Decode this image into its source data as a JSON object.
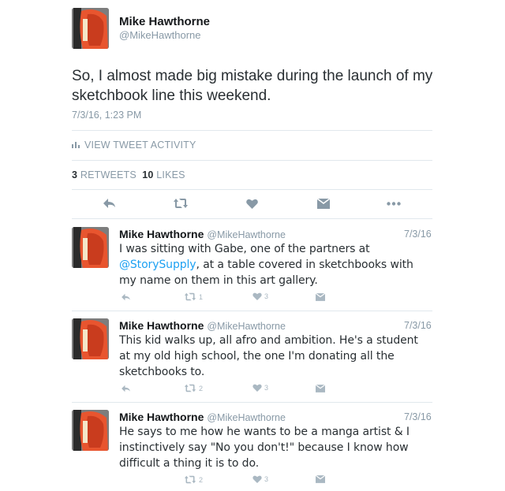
{
  "main_tweet": {
    "user_name": "Mike Hawthorne",
    "handle": "@MikeHawthorne",
    "text": "So, I almost made big mistake during the launch of my sketchbook line this weekend.",
    "timestamp": "7/3/16, 1:23 PM",
    "activity_label": "VIEW TWEET ACTIVITY",
    "retweets_count": "3",
    "retweets_label": "RETWEETS",
    "likes_count": "10",
    "likes_label": "LIKES"
  },
  "replies": [
    {
      "user_name": "Mike Hawthorne",
      "handle": "@MikeHawthorne",
      "date": "7/3/16",
      "text_pre": "I was sitting with Gabe, one of the partners at ",
      "mention": "@StorySupply",
      "text_post": ", at a table covered in sketchbooks with my name on them in this art gallery.",
      "retweets": "1",
      "likes": "3"
    },
    {
      "user_name": "Mike Hawthorne",
      "handle": "@MikeHawthorne",
      "date": "7/3/16",
      "text": "This kid walks up, all afro and ambition. He's a student at my old high school, the one I'm donating all the sketchbooks to.",
      "retweets": "2",
      "likes": "3"
    },
    {
      "user_name": "Mike Hawthorne",
      "handle": "@MikeHawthorne",
      "date": "7/3/16",
      "text": "He says to me how he wants to be a manga artist & I instinctively say \"No you don't!\" because I know how difficult a thing it is to do.",
      "retweets": "2",
      "likes": "3"
    }
  ],
  "colors": {
    "accent": "#1da1f2",
    "muted": "#8899a6",
    "icon": "#aab8c2",
    "divider": "#e1e8ed"
  }
}
